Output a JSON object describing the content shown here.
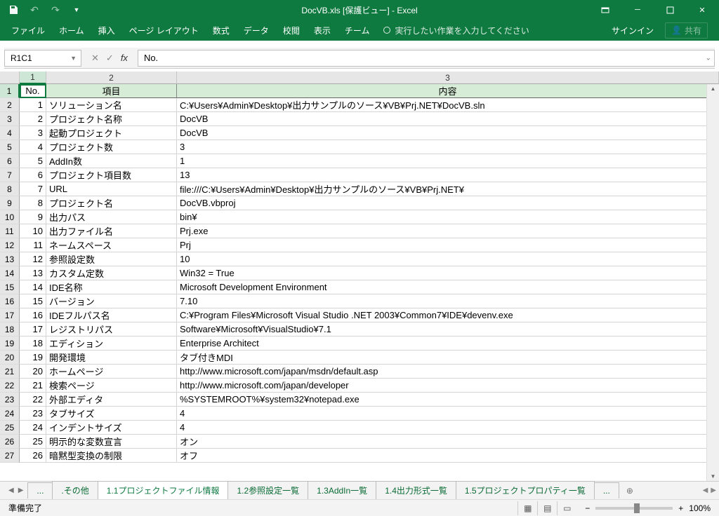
{
  "title": "DocVB.xls  [保護ビュー] - Excel",
  "ribbon": {
    "tabs": [
      "ファイル",
      "ホーム",
      "挿入",
      "ページ レイアウト",
      "数式",
      "データ",
      "校閲",
      "表示",
      "チーム"
    ],
    "tellme": "実行したい作業を入力してください",
    "signin": "サインイン",
    "share": "共有"
  },
  "namebox": "R1C1",
  "fx_value": "No.",
  "col_headers": [
    "1",
    "2",
    "3"
  ],
  "headers": {
    "c1": "No.",
    "c2": "項目",
    "c3": "内容"
  },
  "rows": [
    {
      "n": 1,
      "k": "ソリューション名",
      "v": "C:\\Users\\Admin\\Desktop\\出力サンプルのソース\\VB\\Prj.NET\\DocVB.sln"
    },
    {
      "n": 2,
      "k": "プロジェクト名称",
      "v": "DocVB"
    },
    {
      "n": 3,
      "k": "起動プロジェクト",
      "v": "DocVB"
    },
    {
      "n": 4,
      "k": "プロジェクト数",
      "v": "3"
    },
    {
      "n": 5,
      "k": "AddIn数",
      "v": "1"
    },
    {
      "n": 6,
      "k": "プロジェクト項目数",
      "v": "13"
    },
    {
      "n": 7,
      "k": "URL",
      "v": "file:///C:\\Users\\Admin\\Desktop\\出力サンプルのソース\\VB\\Prj.NET\\"
    },
    {
      "n": 8,
      "k": "プロジェクト名",
      "v": "DocVB.vbproj"
    },
    {
      "n": 9,
      "k": "出力パス",
      "v": "bin\\"
    },
    {
      "n": 10,
      "k": "出力ファイル名",
      "v": "Prj.exe"
    },
    {
      "n": 11,
      "k": "ネームスペース",
      "v": "Prj"
    },
    {
      "n": 12,
      "k": "参照設定数",
      "v": "10"
    },
    {
      "n": 13,
      "k": "カスタム定数",
      "v": "Win32 = True"
    },
    {
      "n": 14,
      "k": "IDE名称",
      "v": "Microsoft Development Environment"
    },
    {
      "n": 15,
      "k": "バージョン",
      "v": "7.10"
    },
    {
      "n": 16,
      "k": "IDEフルパス名",
      "v": "C:\\Program Files\\Microsoft Visual Studio .NET 2003\\Common7\\IDE\\devenv.exe"
    },
    {
      "n": 17,
      "k": "レジストリパス",
      "v": "Software\\Microsoft\\VisualStudio\\7.1"
    },
    {
      "n": 18,
      "k": "エディション",
      "v": "Enterprise Architect"
    },
    {
      "n": 19,
      "k": "開発環境",
      "v": "タブ付きMDI"
    },
    {
      "n": 20,
      "k": "ホームページ",
      "v": "http://www.microsoft.com/japan/msdn/default.asp"
    },
    {
      "n": 21,
      "k": "検索ページ",
      "v": "http://www.microsoft.com/japan/developer"
    },
    {
      "n": 22,
      "k": "外部エディタ",
      "v": "%SYSTEMROOT%\\system32\\notepad.exe"
    },
    {
      "n": 23,
      "k": "タブサイズ",
      "v": "4"
    },
    {
      "n": 24,
      "k": "インデントサイズ",
      "v": "4"
    },
    {
      "n": 25,
      "k": "明示的な変数宣言",
      "v": "オン"
    },
    {
      "n": 26,
      "k": "暗黙型変換の制限",
      "v": "オフ"
    }
  ],
  "sheet_tabs": {
    "ellipsis": "...",
    "items": [
      ".その他",
      "1.1プロジェクトファイル情報",
      "1.2参照設定一覧",
      "1.3AddIn一覧",
      "1.4出力形式一覧",
      "1.5プロジェクトプロパティ一覧"
    ],
    "active": 1
  },
  "status": {
    "ready": "準備完了",
    "zoom": "100%"
  }
}
